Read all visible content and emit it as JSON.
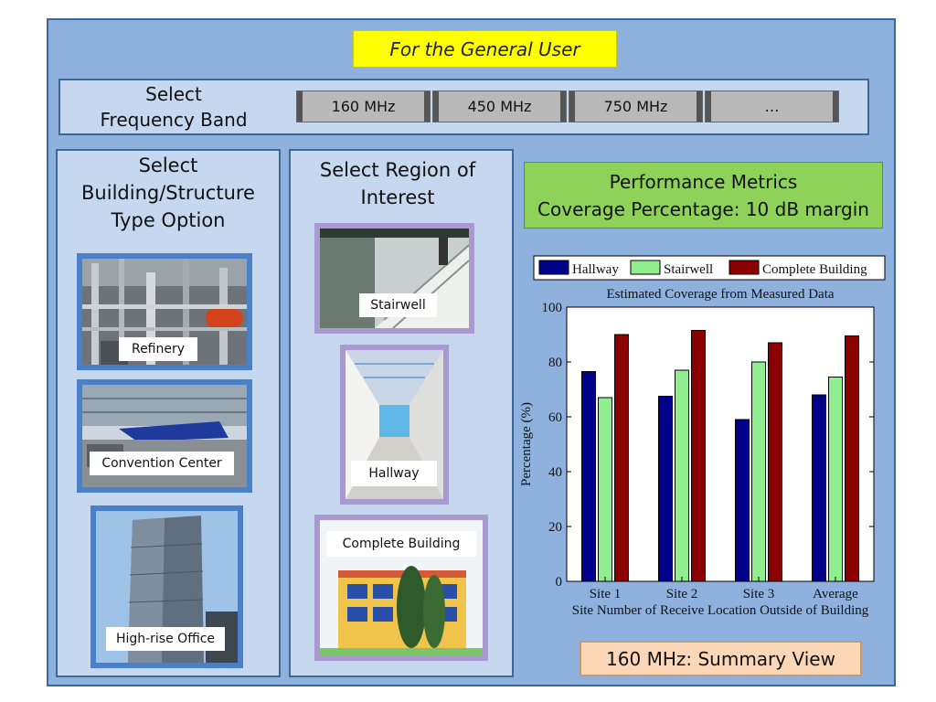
{
  "banner": "For the General User",
  "frequency": {
    "title_line1": "Select",
    "title_line2": "Frequency Band",
    "buttons": [
      "160 MHz",
      "450 MHz",
      "750 MHz",
      "…"
    ]
  },
  "building": {
    "title_line1": "Select",
    "title_line2": "Building/Structure",
    "title_line3": "Type Option",
    "options": [
      "Refinery",
      "Convention Center",
      "High-rise Office"
    ]
  },
  "region": {
    "title_line1": "Select Region of",
    "title_line2": "Interest",
    "options": [
      "Stairwell",
      "Hallway",
      "Complete Building"
    ]
  },
  "metrics": {
    "line1": "Performance Metrics",
    "line2": "Coverage Percentage: 10 dB margin"
  },
  "summary_button": "160 MHz: Summary View",
  "colors": {
    "hallway": "#00008b",
    "stairwell": "#90ee90",
    "complete": "#8b0000"
  },
  "chart_data": {
    "type": "bar",
    "title": "Estimated Coverage from Measured Data",
    "xlabel": "Site Number of Receive Location Outside of Building",
    "ylabel": "Percentage (%)",
    "categories": [
      "Site 1",
      "Site 2",
      "Site 3",
      "Average"
    ],
    "ylim": [
      0,
      100
    ],
    "yticks": [
      0,
      20,
      40,
      60,
      80,
      100
    ],
    "legend_position": "top",
    "series": [
      {
        "name": "Hallway",
        "color": "#00008b",
        "values": [
          76.5,
          67.5,
          59,
          68
        ]
      },
      {
        "name": "Stairwell",
        "color": "#90ee90",
        "values": [
          67,
          77,
          80,
          74.5
        ]
      },
      {
        "name": "Complete Building",
        "color": "#8b0000",
        "values": [
          90,
          91.5,
          87,
          89.5
        ]
      }
    ]
  }
}
